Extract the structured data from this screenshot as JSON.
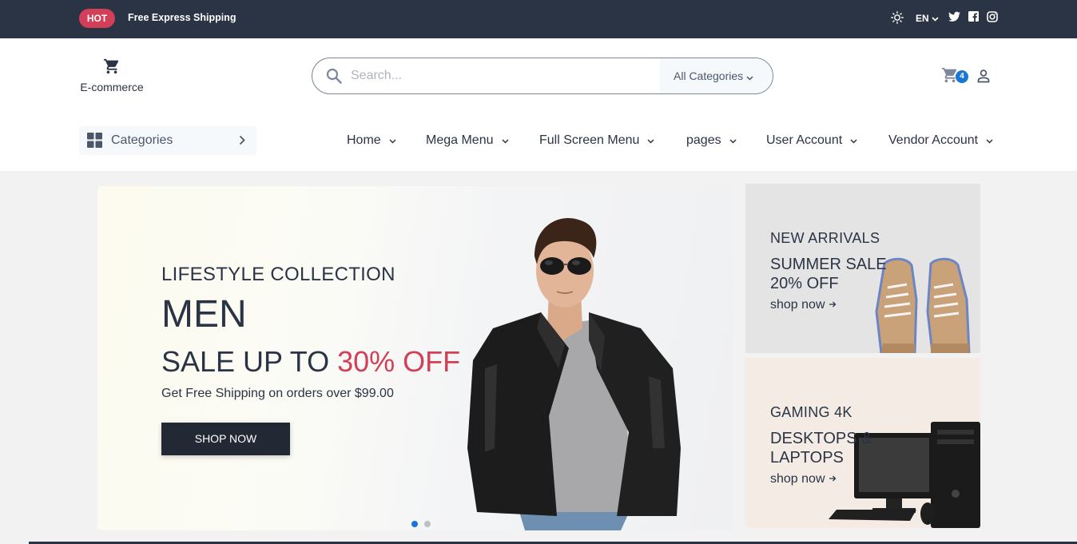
{
  "topbar": {
    "badge": "HOT",
    "shipping": "Free Express Shipping",
    "language": "EN"
  },
  "header": {
    "logo_text": "E-commerce",
    "search": {
      "placeholder": "Search...",
      "category": "All Categories"
    },
    "cart_count": "4"
  },
  "nav": {
    "categories_label": "Categories",
    "items": [
      "Home",
      "Mega Menu",
      "Full Screen Menu",
      "pages",
      "User Account",
      "Vendor Account"
    ]
  },
  "hero": {
    "subtitle": "LIFESTYLE COLLECTION",
    "title": "MEN",
    "sale_prefix": "SALE UP TO ",
    "sale_highlight": "30% OFF",
    "description": "Get Free Shipping on orders over $99.00",
    "button": "SHOP NOW",
    "slide_count": 2,
    "active_slide": 1
  },
  "promos": [
    {
      "tag": "NEW ARRIVALS",
      "title": "SUMMER SALE 20% OFF",
      "link": "shop now"
    },
    {
      "tag": "GAMING 4K",
      "title": "DESKTOPS & LAPTOPS",
      "link": "shop now"
    }
  ],
  "colors": {
    "topbar": "#2b3445",
    "accent": "#d23f57",
    "primary": "#1976d2",
    "text": "#2b3445"
  }
}
